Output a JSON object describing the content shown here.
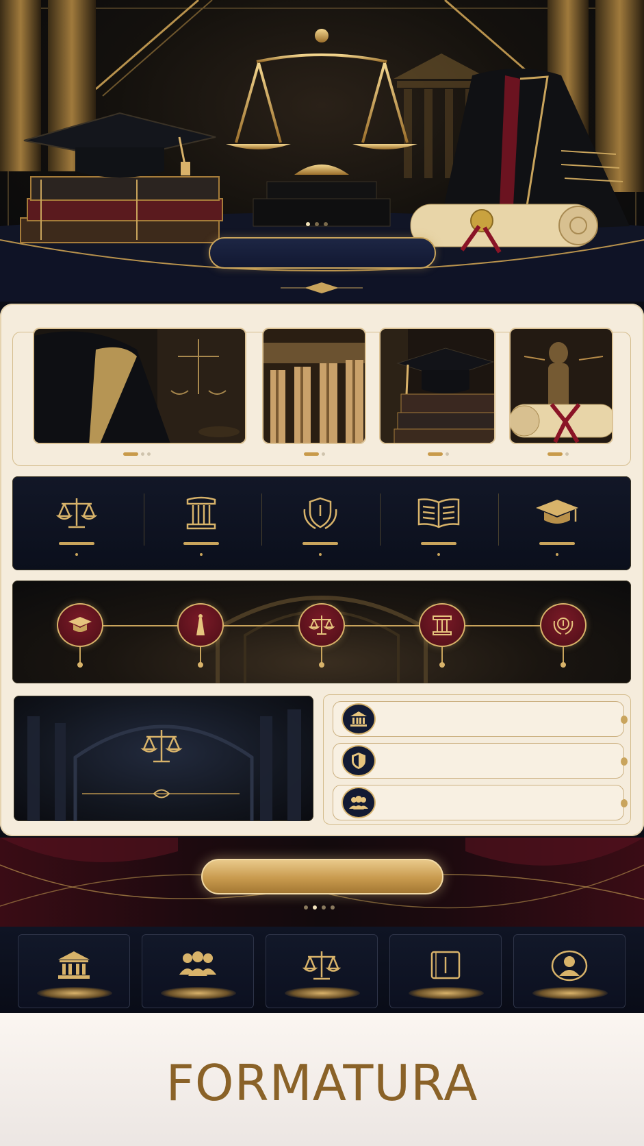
{
  "hero": {
    "carousel_dots": 3,
    "active_dot": 0
  },
  "gallery": {
    "photos": [
      "graduation-gown-photo",
      "courthouse-columns-photo",
      "graduation-cap-books-photo",
      "diploma-justice-statue-photo"
    ]
  },
  "strip_icons": [
    "scales-icon",
    "column-icon",
    "shield-laurel-icon",
    "open-book-icon",
    "graduation-cap-icon"
  ],
  "timeline_icons": [
    "graduation-cap-icon",
    "tassel-icon",
    "scales-icon",
    "column-icon",
    "laurel-seal-icon"
  ],
  "list_items": [
    "courthouse-icon",
    "shield-icon",
    "people-icon"
  ],
  "cta": {
    "dots": 4,
    "active_dot": 1
  },
  "nav_icons": [
    "courthouse-icon",
    "people-icon",
    "scales-icon",
    "book-icon",
    "user-icon"
  ],
  "footer": {
    "title": "FORMATURA"
  },
  "colors": {
    "gold": "#c9a45c",
    "navy": "#121a33",
    "burgundy": "#6b1320",
    "cream": "#f5ecdc",
    "title": "#8a6228"
  }
}
